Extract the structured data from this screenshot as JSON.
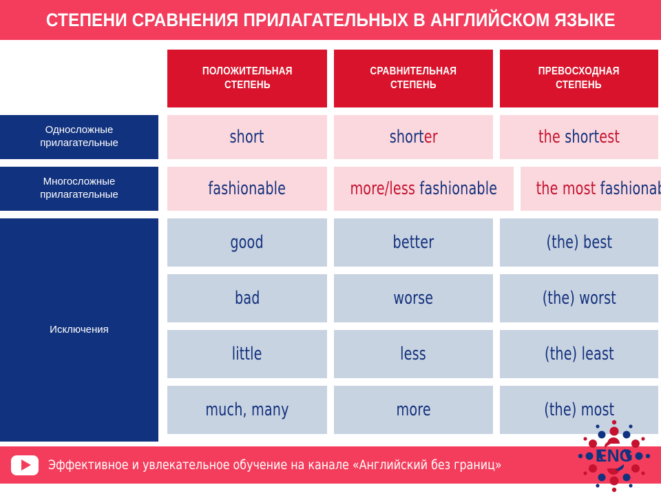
{
  "title": "СТЕПЕНИ СРАВНЕНИЯ ПРИЛАГАТЕЛЬНЫХ В АНГЛИЙСКОМ ЯЗЫКЕ",
  "colors": {
    "band_pink": "#F43D5C",
    "header_red": "#D8132B",
    "navy": "#11327E",
    "text_navy": "#12307C",
    "highlight_red": "#C4122F",
    "cell_pink": "#FBD8DE",
    "cell_gray": "#C8D3E1"
  },
  "headers": [
    {
      "line1": "ПОЛОЖИТЕЛЬНАЯ",
      "line2": "СТЕПЕНЬ"
    },
    {
      "line1": "СРАВНИТЕЛЬНАЯ",
      "line2": "СТЕПЕНЬ"
    },
    {
      "line1": "ПРЕВОСХОДНАЯ",
      "line2": "СТЕПЕНЬ"
    }
  ],
  "row_labels": {
    "monosyllabic_line1": "Односложные",
    "monosyllabic_line2": "прилагательные",
    "polysyllabic_line1": "Многосложные",
    "polysyllabic_line2": "прилагательные",
    "exceptions": "Исключения"
  },
  "rows": {
    "monosyllabic": {
      "positive": "short",
      "comparative_base": "short",
      "comparative_suffix": "er",
      "superlative_the": "the ",
      "superlative_base": "short",
      "superlative_suffix": "est"
    },
    "polysyllabic": {
      "positive": "fashionable",
      "comparative_prefix": "more/less ",
      "comparative_base": "fashionable",
      "superlative_prefix": "the most ",
      "superlative_base": "fashionable"
    },
    "exceptions": [
      {
        "positive": "good",
        "comparative": "better",
        "superlative": "(the) best"
      },
      {
        "positive": "bad",
        "comparative": "worse",
        "superlative": "(the) worst"
      },
      {
        "positive": "little",
        "comparative": "less",
        "superlative": "(the) least"
      },
      {
        "positive": "much, many",
        "comparative": "more",
        "superlative": "(the) most"
      }
    ]
  },
  "footer": {
    "text": "Эффективное и увлекательное обучение на канале «Английский без границ»",
    "logo_label": "ENG"
  }
}
